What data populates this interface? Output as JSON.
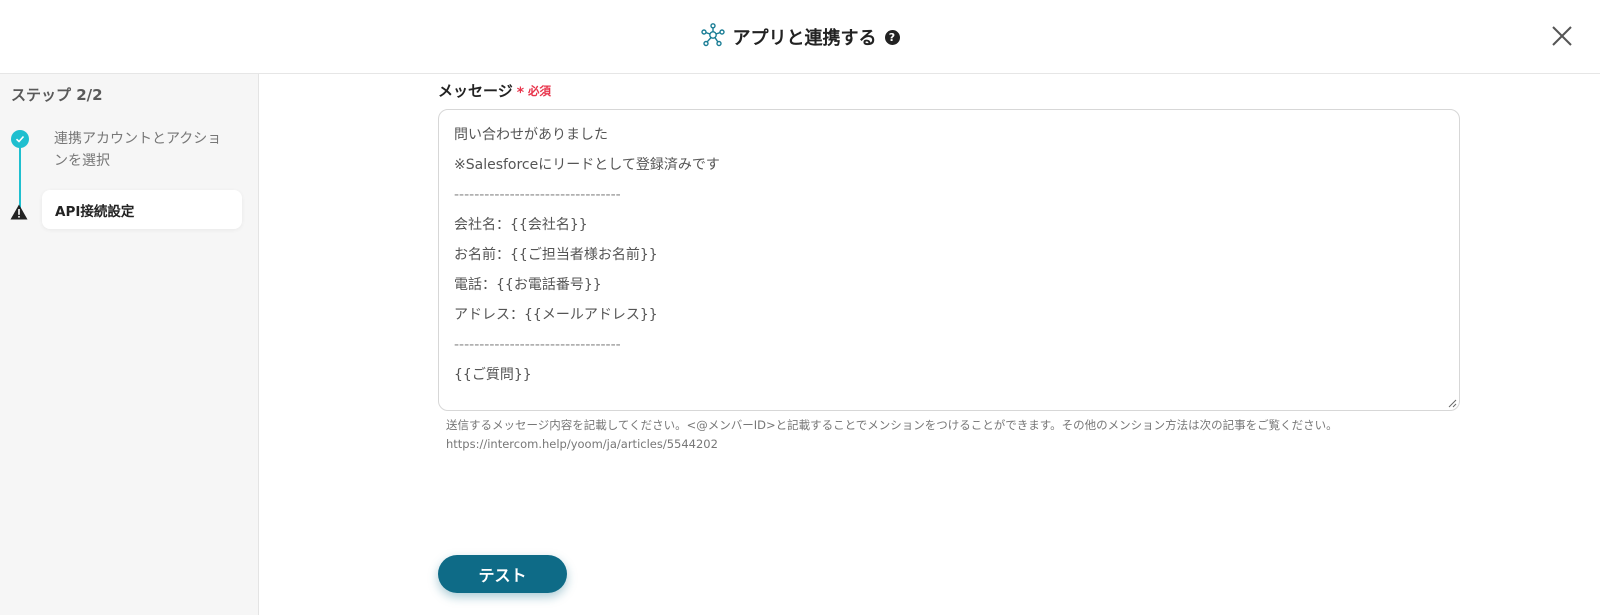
{
  "header": {
    "title": "アプリと連携する",
    "help_icon": "question-circle-icon",
    "close_icon": "close-icon"
  },
  "sidebar": {
    "step_label": "ステップ 2/2",
    "steps": [
      {
        "label": "連携アカウントとアクションを選択",
        "status": "done",
        "icon": "check-circle-icon"
      },
      {
        "label": "API接続設定",
        "status": "warning",
        "icon": "warning-icon"
      }
    ]
  },
  "form": {
    "label": "メッセージ",
    "required_mark": "*",
    "required_text": "必須",
    "message_lines": [
      "問い合わせがありました",
      "※Salesforceにリードとして登録済みです",
      "---------------------------------",
      "会社名：{{会社名}}",
      "お名前：{{ご担当者様お名前}}",
      "電話：{{お電話番号}}",
      "アドレス：{{メールアドレス}}",
      "---------------------------------",
      "{{ご質問}}"
    ],
    "hint_line1": "送信するメッセージ内容を記載してください。<@メンバーID>と記載することでメンションをつけることができます。その他のメンション方法は次の記事をご覧ください。",
    "hint_line2": "https://intercom.help/yoom/ja/articles/5544202"
  },
  "actions": {
    "test_label": "テスト"
  },
  "colors": {
    "accent": "#1fbfcf",
    "primary_button": "#0e6b87",
    "required": "#e8334a"
  }
}
